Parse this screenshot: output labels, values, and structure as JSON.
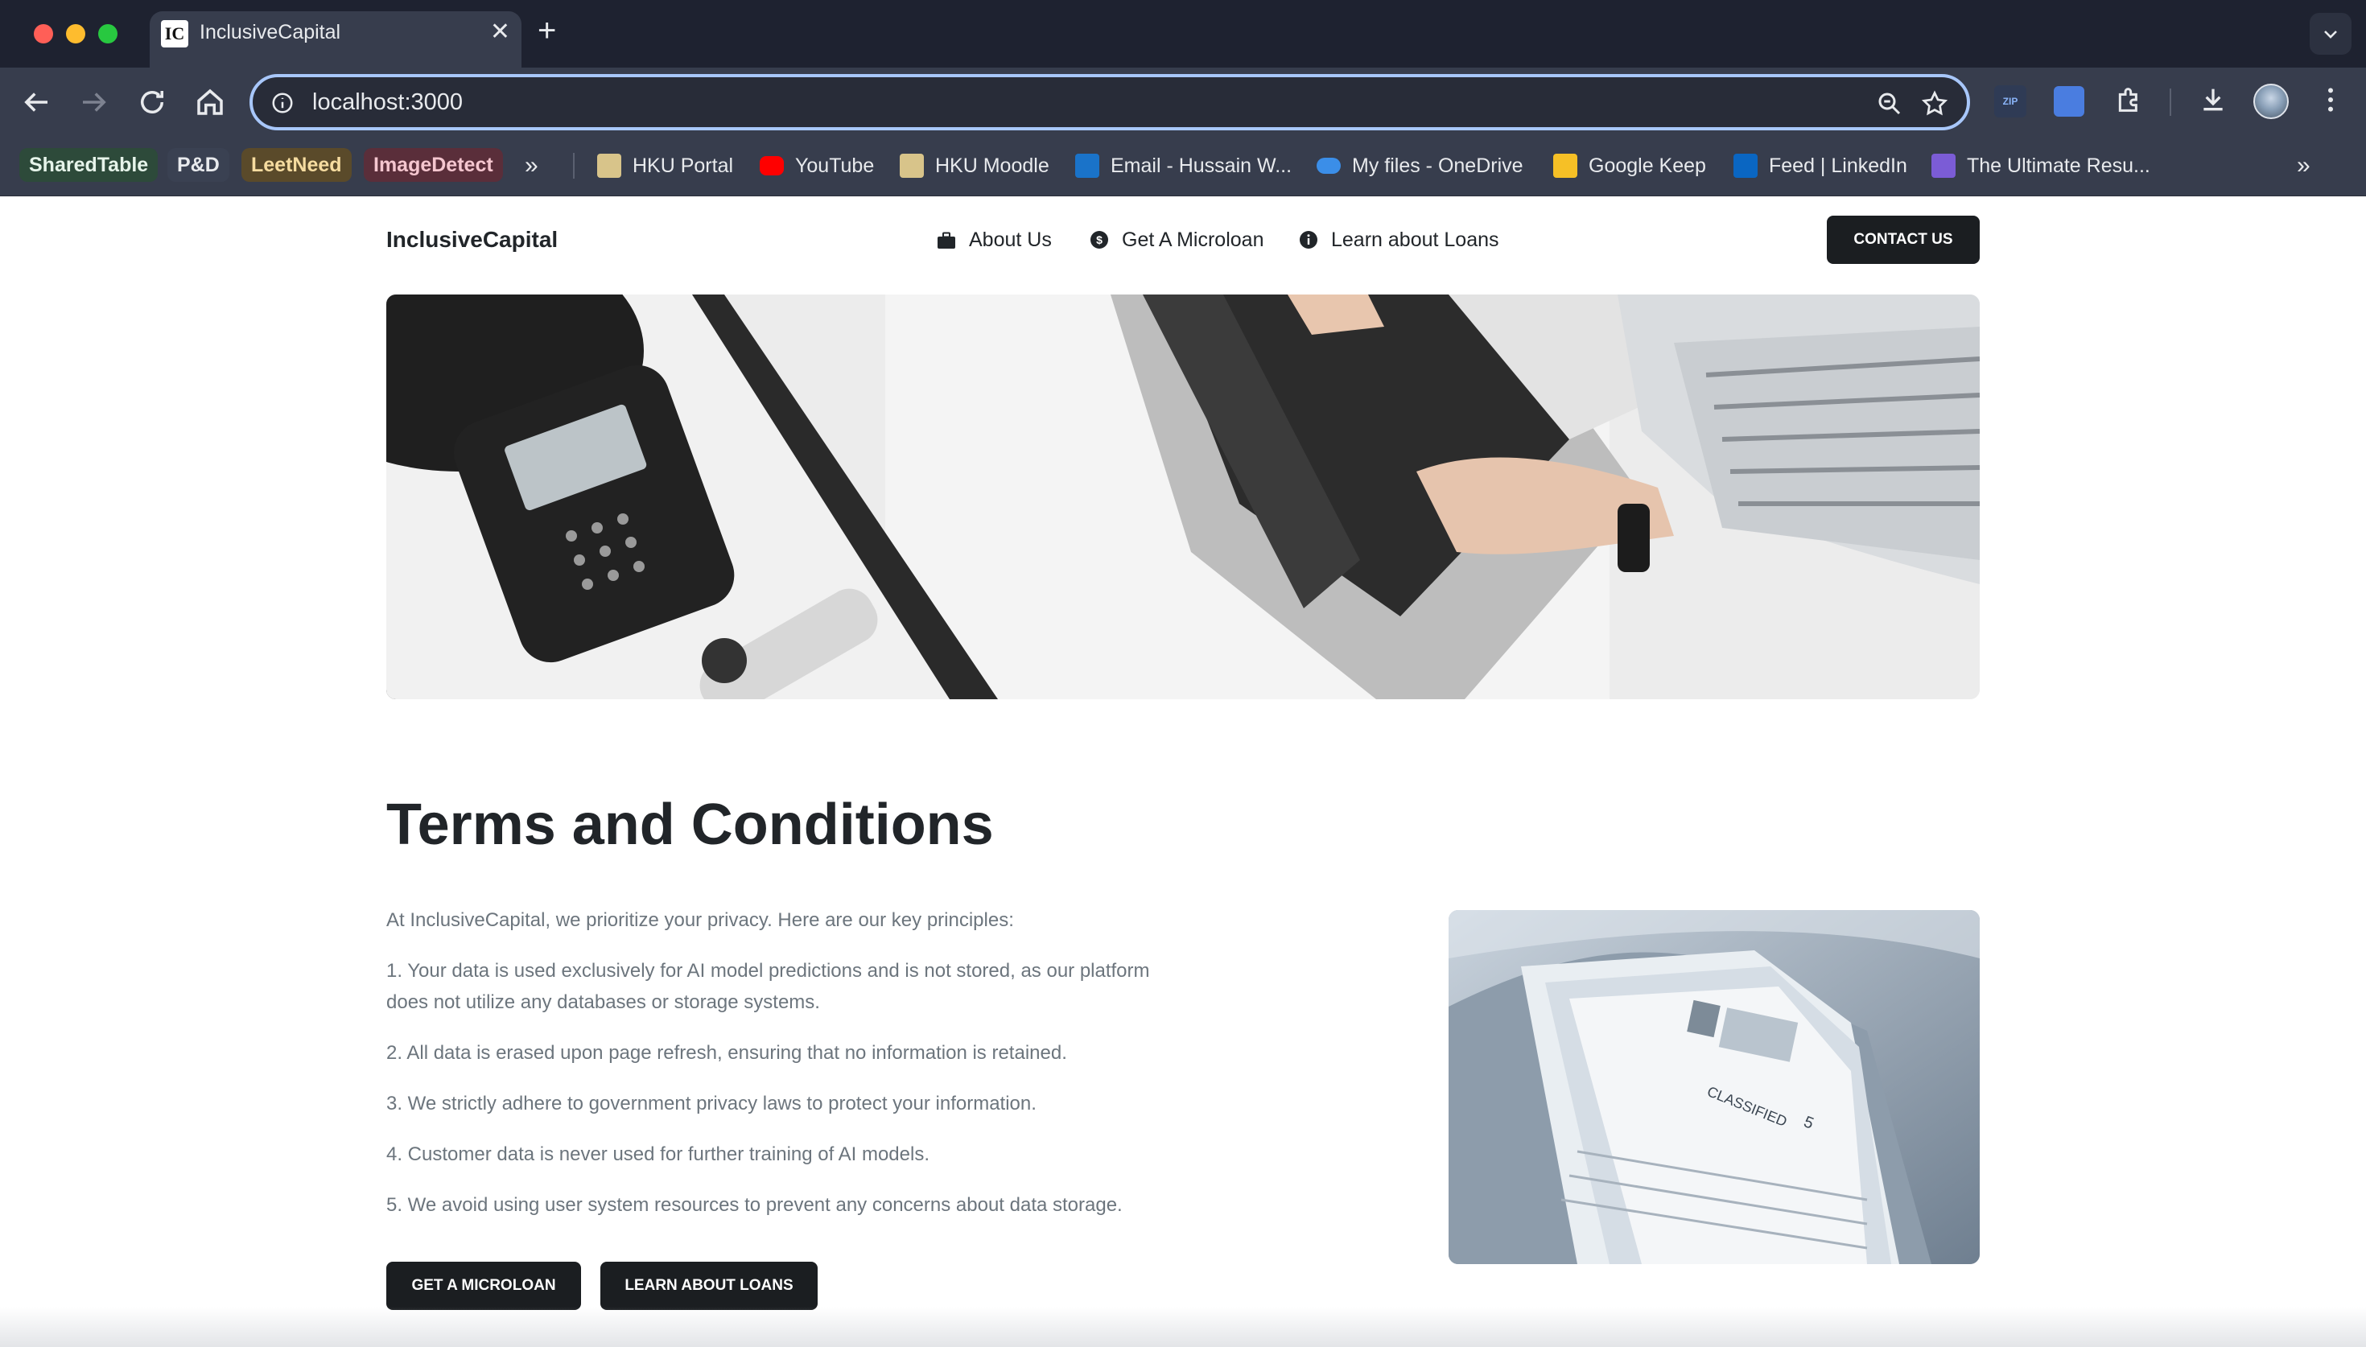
{
  "browser": {
    "tab_title": "InclusiveCapital",
    "tab_favicon_text": "IC",
    "url": "localhost:3000",
    "ext_zip_label": "ZIP",
    "bookmarks_chips": [
      {
        "label": "SharedTable",
        "bg": "#2d4a3a",
        "fg": "#e6f4ea"
      },
      {
        "label": "P&D",
        "bg": "#3a4152",
        "fg": "#e8eaed"
      },
      {
        "label": "LeetNeed",
        "bg": "#5a4a2a",
        "fg": "#f6dca0"
      },
      {
        "label": "ImageDetect",
        "bg": "#5a2e3a",
        "fg": "#f5c6cf"
      }
    ],
    "bookmarks": [
      {
        "label": "HKU Portal",
        "icon": "hku-portal-icon"
      },
      {
        "label": "YouTube",
        "icon": "youtube-icon"
      },
      {
        "label": "HKU Moodle",
        "icon": "hku-moodle-icon"
      },
      {
        "label": "Email - Hussain W...",
        "icon": "outlook-icon"
      },
      {
        "label": "My files - OneDrive",
        "icon": "onedrive-icon"
      },
      {
        "label": "Google Keep",
        "icon": "google-keep-icon"
      },
      {
        "label": "Feed | LinkedIn",
        "icon": "linkedin-icon"
      },
      {
        "label": "The Ultimate Resu...",
        "icon": "resume-icon"
      }
    ]
  },
  "site": {
    "brand": "InclusiveCapital",
    "nav": [
      {
        "label": "About Us",
        "icon": "briefcase-icon"
      },
      {
        "label": "Get A Microloan",
        "icon": "dollar-circle-icon"
      },
      {
        "label": "Learn about Loans",
        "icon": "info-circle-icon"
      }
    ],
    "contact_label": "CONTACT US",
    "hero_alt": "",
    "title": "Terms and Conditions",
    "intro": "At InclusiveCapital, we prioritize your privacy. Here are our key principles:",
    "points": [
      "1. Your data is used exclusively for AI model predictions and is not stored, as our platform does not utilize any databases or storage systems.",
      "2. All data is erased upon page refresh, ensuring that no information is retained.",
      "3. We strictly adhere to government privacy laws to protect your information.",
      "4. Customer data is never used for further training of AI models.",
      "5. We avoid using user system resources to prevent any concerns about data storage."
    ],
    "btn_microloan": "GET A MICROLOAN",
    "btn_learn": "LEARN ABOUT LOANS",
    "side_img_text1": "CLASSIFIED",
    "side_img_text2": "5"
  },
  "colors": {
    "button_dark": "#1b1e21",
    "text_primary": "#212529",
    "text_muted": "#6c757d",
    "chrome_bg": "#1e2230",
    "toolbar_bg": "#373d4d",
    "focus_ring": "#a8c7fa"
  }
}
